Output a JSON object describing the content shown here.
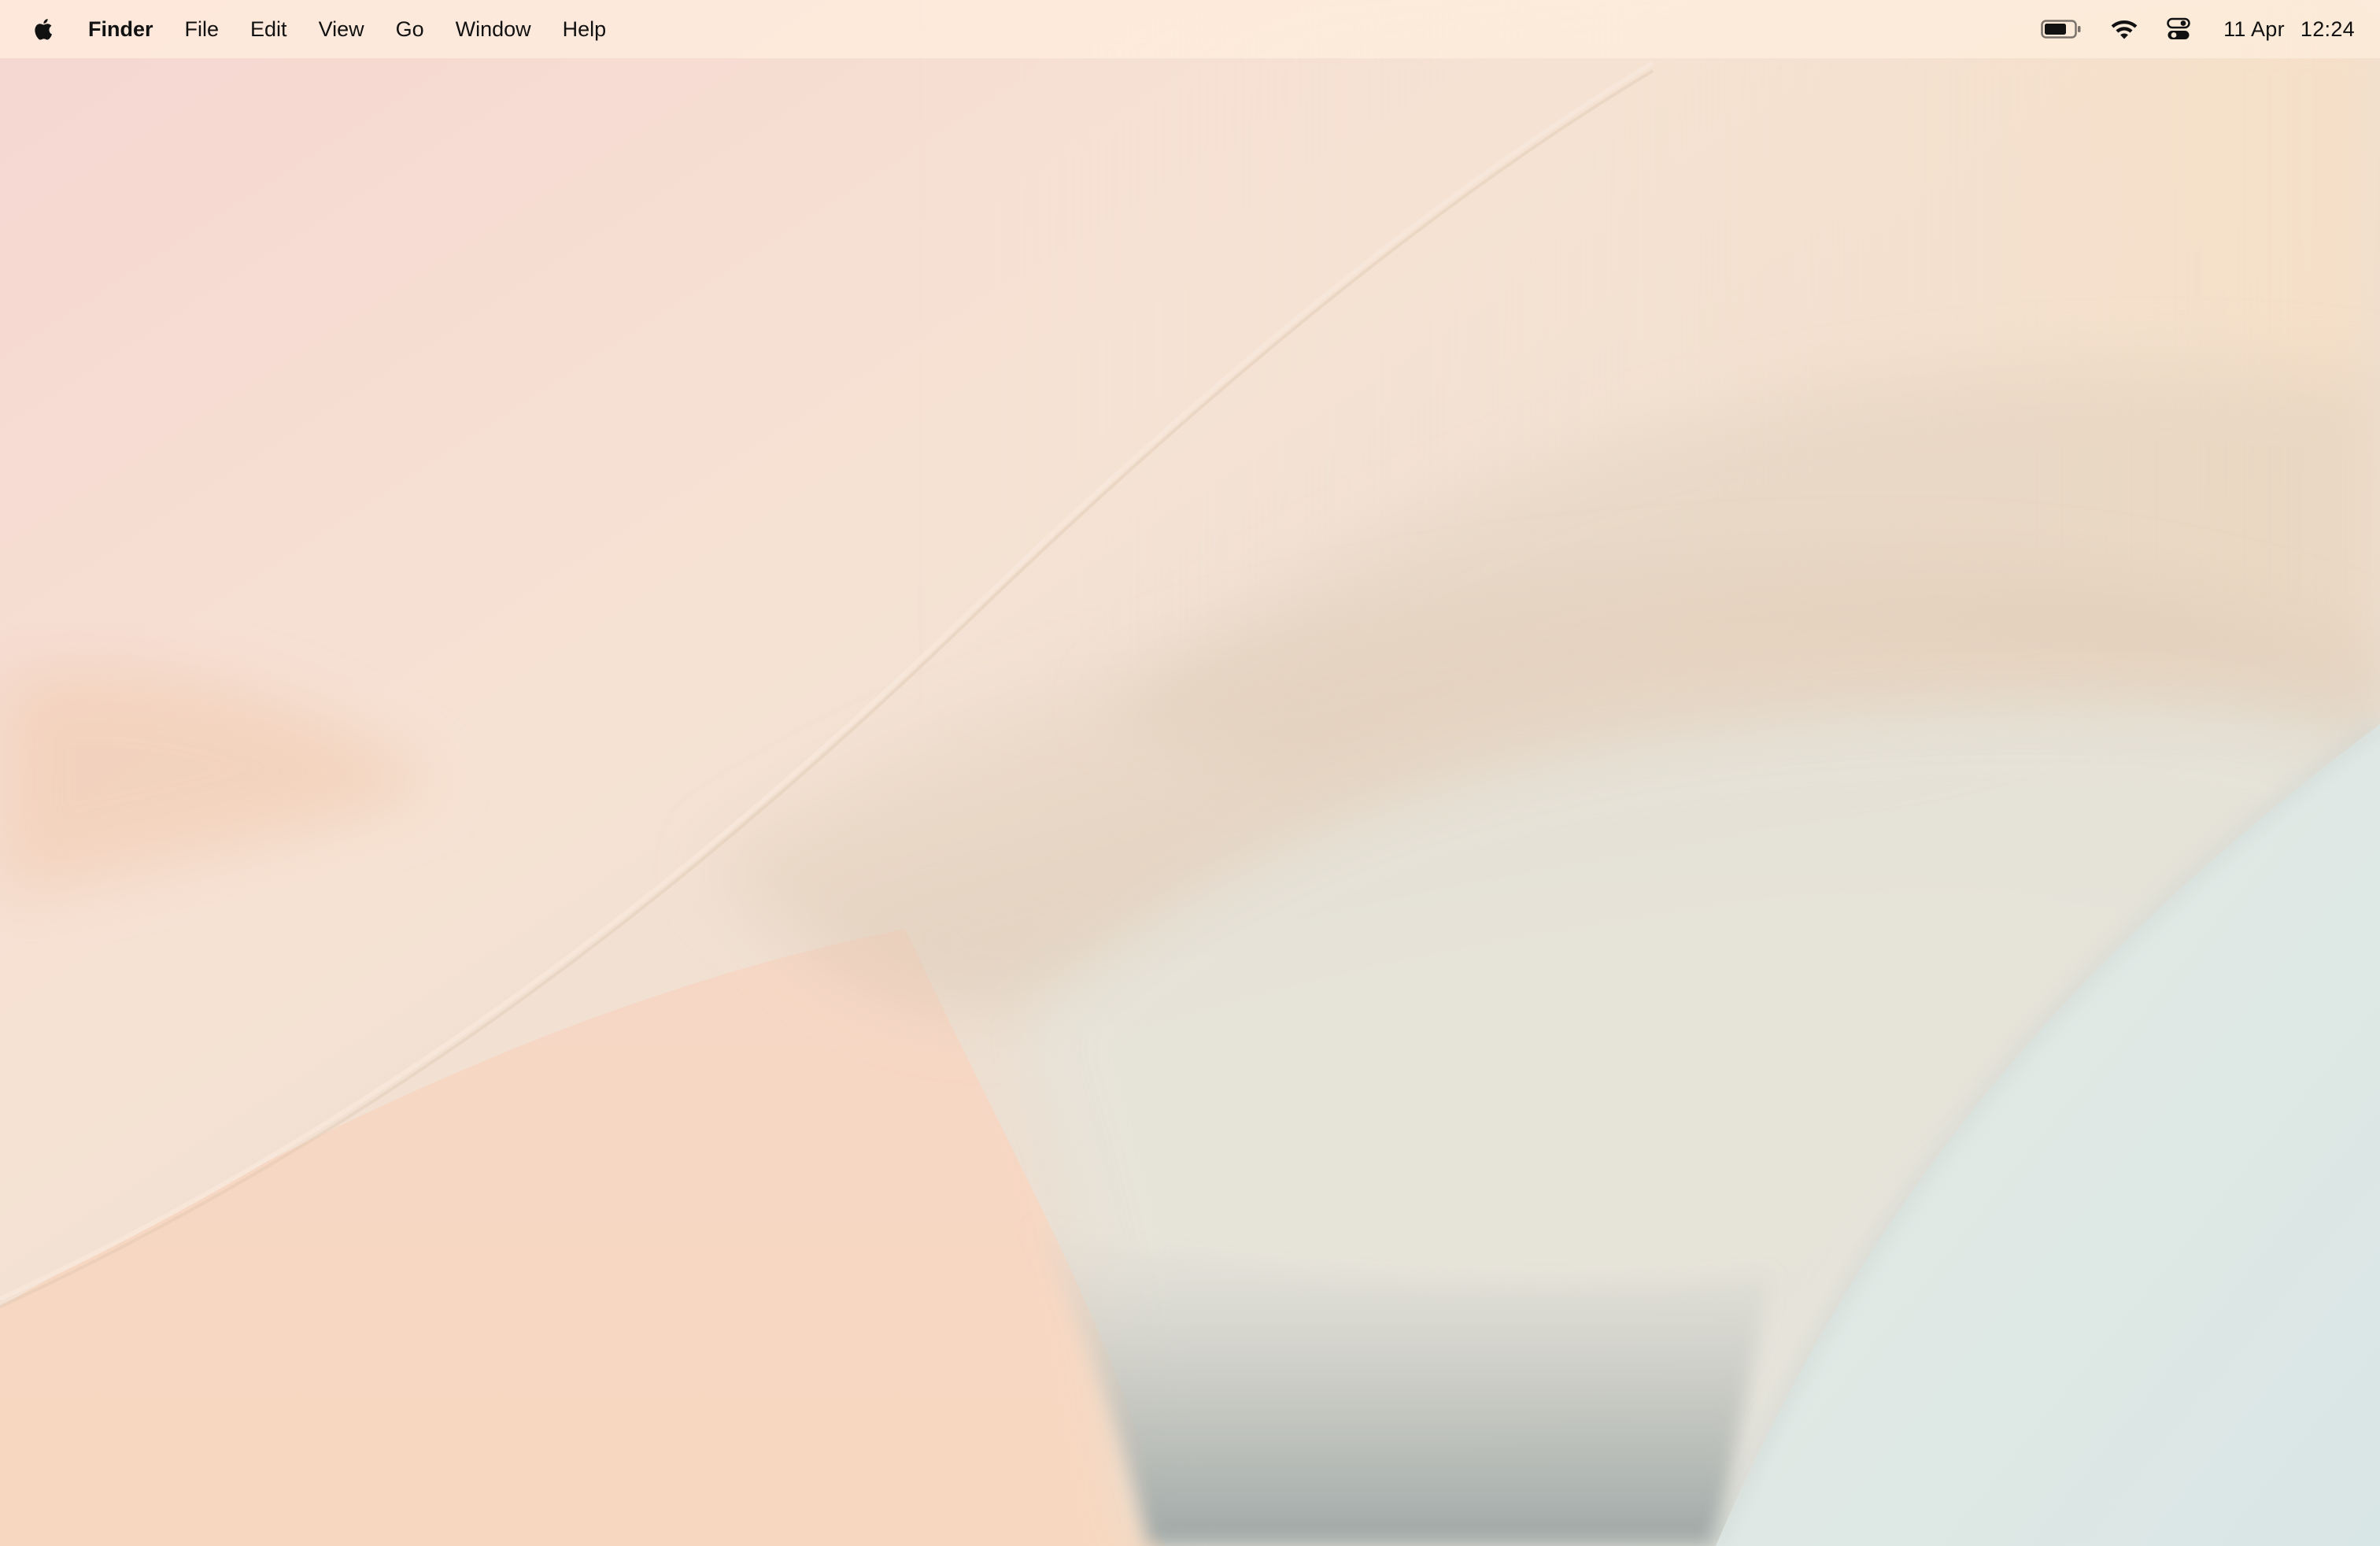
{
  "menubar": {
    "apple_icon": "apple-logo-icon",
    "app_name": "Finder",
    "items": [
      {
        "label": "File"
      },
      {
        "label": "Edit"
      },
      {
        "label": "View"
      },
      {
        "label": "Go"
      },
      {
        "label": "Window"
      },
      {
        "label": "Help"
      }
    ],
    "status": {
      "battery_icon": "battery-icon",
      "battery_level": 0.75,
      "wifi_icon": "wifi-icon",
      "control_center_icon": "control-center-icon",
      "date": "11 Apr",
      "time": "12:24"
    }
  },
  "desktop": {
    "wallpaper_colors": [
      "#f6d9d1",
      "#f6e3cf",
      "#e9ddd0",
      "#dfe6e2",
      "#a9b2b0"
    ]
  }
}
